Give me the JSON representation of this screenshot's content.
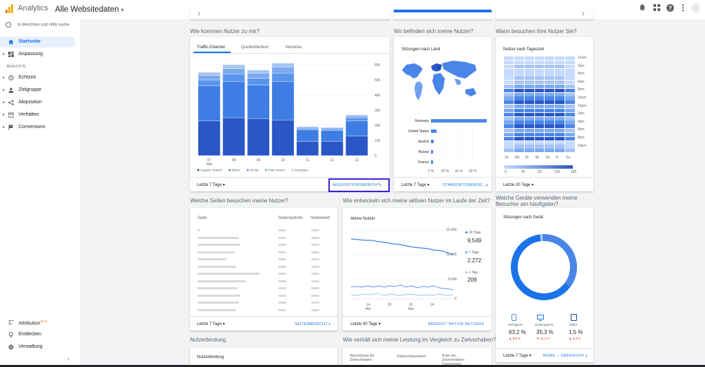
{
  "header": {
    "brand": "Analytics",
    "property": "Alle Websitedaten",
    "property_caret": "▾"
  },
  "sidebar": {
    "search_placeholder": "In Berichten und Hilfe suche",
    "items": [
      {
        "label": "Startseite",
        "icon": "home-icon"
      },
      {
        "label": "Anpassung",
        "icon": "dashboard-icon"
      }
    ],
    "section_label": "BERICHTE",
    "reports": [
      {
        "label": "Echtzeit",
        "icon": "clock-icon"
      },
      {
        "label": "Zielgruppe",
        "icon": "person-icon"
      },
      {
        "label": "Akquisition",
        "icon": "acquisition-icon"
      },
      {
        "label": "Verhalten",
        "icon": "behavior-icon"
      },
      {
        "label": "Conversions",
        "icon": "flag-icon"
      }
    ],
    "bottom": [
      {
        "label": "Attribution",
        "badge": "BETA",
        "icon": "attribution-icon"
      },
      {
        "label": "Entdecken",
        "icon": "lightbulb-icon"
      },
      {
        "label": "Verwaltung",
        "icon": "gear-icon"
      }
    ],
    "collapse": "‹"
  },
  "traffic": {
    "question": "Wie kommen Nutzer zu mir?",
    "tabs": [
      "Traffic-Channel",
      "Quelle/Medium",
      "Verweise"
    ],
    "range": "Letzte 7 Tage ▾",
    "link": "AKQUISITIONSBERICHT",
    "arrow": "›"
  },
  "geo": {
    "question": "Wo befinden sich meine Nutzer?",
    "head": "Sitzungen nach Land",
    "range": "Letzte 7 Tage ▾",
    "link": "STANDORTÜBERSIC...",
    "arrow": "›",
    "countries": [
      "Germany",
      "United States",
      "Austria",
      "Russia",
      "France"
    ],
    "share_ticks": [
      "0 %",
      "20 %",
      "40 %",
      "60 %"
    ],
    "values": [
      80,
      8,
      4,
      2,
      2
    ]
  },
  "time": {
    "question": "Wann besuchen Ihre Nutzer Sie?",
    "head": "Nutzer nach Tageszeit",
    "hours": [
      "12am",
      "2am",
      "4am",
      "6am",
      "8am",
      "10am",
      "12pm",
      "2pm",
      "4pm",
      "6pm",
      "8pm",
      "10pm"
    ],
    "days": [
      "So",
      "Mo",
      "Di",
      "Mi",
      "Do",
      "Fr",
      "Sa"
    ],
    "scale": [
      "0",
      "45",
      "90",
      "135",
      "180"
    ],
    "range": "Letzte 30 Tage ▾"
  },
  "pages": {
    "question": "Welche Seiten besuchen meine Nutzer?",
    "col_page": "Seite",
    "col_views": "Seitenaufrufe",
    "col_value": "Seitenwert",
    "range": "Letzte 7 Tage ▾",
    "link": "SEITENBERICHT",
    "arrow": "›"
  },
  "active": {
    "question": "Wie entwickeln sich meine aktiven Nutzer im Laufe der Zeit?",
    "head": "Aktive Nutzer",
    "y_ticks": [
      "15.000",
      "10.000",
      "5.000",
      "0"
    ],
    "x_ticks": [
      "14",
      "Apr.",
      "20",
      "02",
      "Mai",
      "24"
    ],
    "legend": [
      {
        "label": "30 Tage",
        "value": "9.549"
      },
      {
        "label": "7 Tage",
        "value": "2.272"
      },
      {
        "label": "1 Tag",
        "value": "209"
      }
    ],
    "range": "Letzte 90 Tage ▾",
    "link": "BERICHT \"AKTIVE NUTZER\"",
    "arrow": "›"
  },
  "devices": {
    "question": "Welche Geräte verwenden meine Besucher am häufigsten?",
    "head": "Sitzungen nach Gerät",
    "items": [
      {
        "label": "Mobilgerät",
        "pct": "63,2 %",
        "delta": "▲ 9,6 %"
      },
      {
        "label": "Desktopgerät",
        "pct": "35,3 %",
        "delta": "▼ 11,3 %"
      },
      {
        "label": "Tablet",
        "pct": "1,5 %",
        "delta": "▲ 6,3 %"
      }
    ],
    "range": "Letzte 7 Tage ▾",
    "link": "MOBIL – ÜBERSICHT",
    "arrow": "›"
  },
  "retention": {
    "question": "Nutzerbindung",
    "head": "Nutzerbindung"
  },
  "goals": {
    "question": "Wie verhält sich meine Leistung im Vergleich zu Zielvorhaben?",
    "col1": "Abschlüsse für Zielvorhaben",
    "col2": "Zielvorhabenwert",
    "col3": "Rate der Zielvorhaben-Conversion"
  },
  "chart_data": {
    "type": "bar",
    "categories": [
      "07 Mai",
      "08",
      "09",
      "10",
      "11",
      "12",
      "13"
    ],
    "series": [
      {
        "name": "Organic Search",
        "values": [
          230,
          250,
          245,
          235,
          95,
          95,
          130
        ]
      },
      {
        "name": "Direct",
        "values": [
          230,
          240,
          220,
          255,
          75,
          70,
          100
        ]
      },
      {
        "name": "Social",
        "values": [
          40,
          50,
          45,
          55,
          10,
          10,
          20
        ]
      },
      {
        "name": "Paid Search",
        "values": [
          30,
          35,
          35,
          40,
          8,
          8,
          12
        ]
      },
      {
        "name": "Sonstiges",
        "values": [
          20,
          25,
          20,
          25,
          5,
          5,
          8
        ]
      }
    ],
    "colors": [
      "#2a56c6",
      "#3d7de4",
      "#5a95ec",
      "#7ca9ef",
      "#a6c4f3"
    ],
    "y_ticks": [
      "600",
      "500",
      "400",
      "300",
      "200",
      "100",
      "0"
    ],
    "ylim": [
      0,
      600
    ]
  }
}
